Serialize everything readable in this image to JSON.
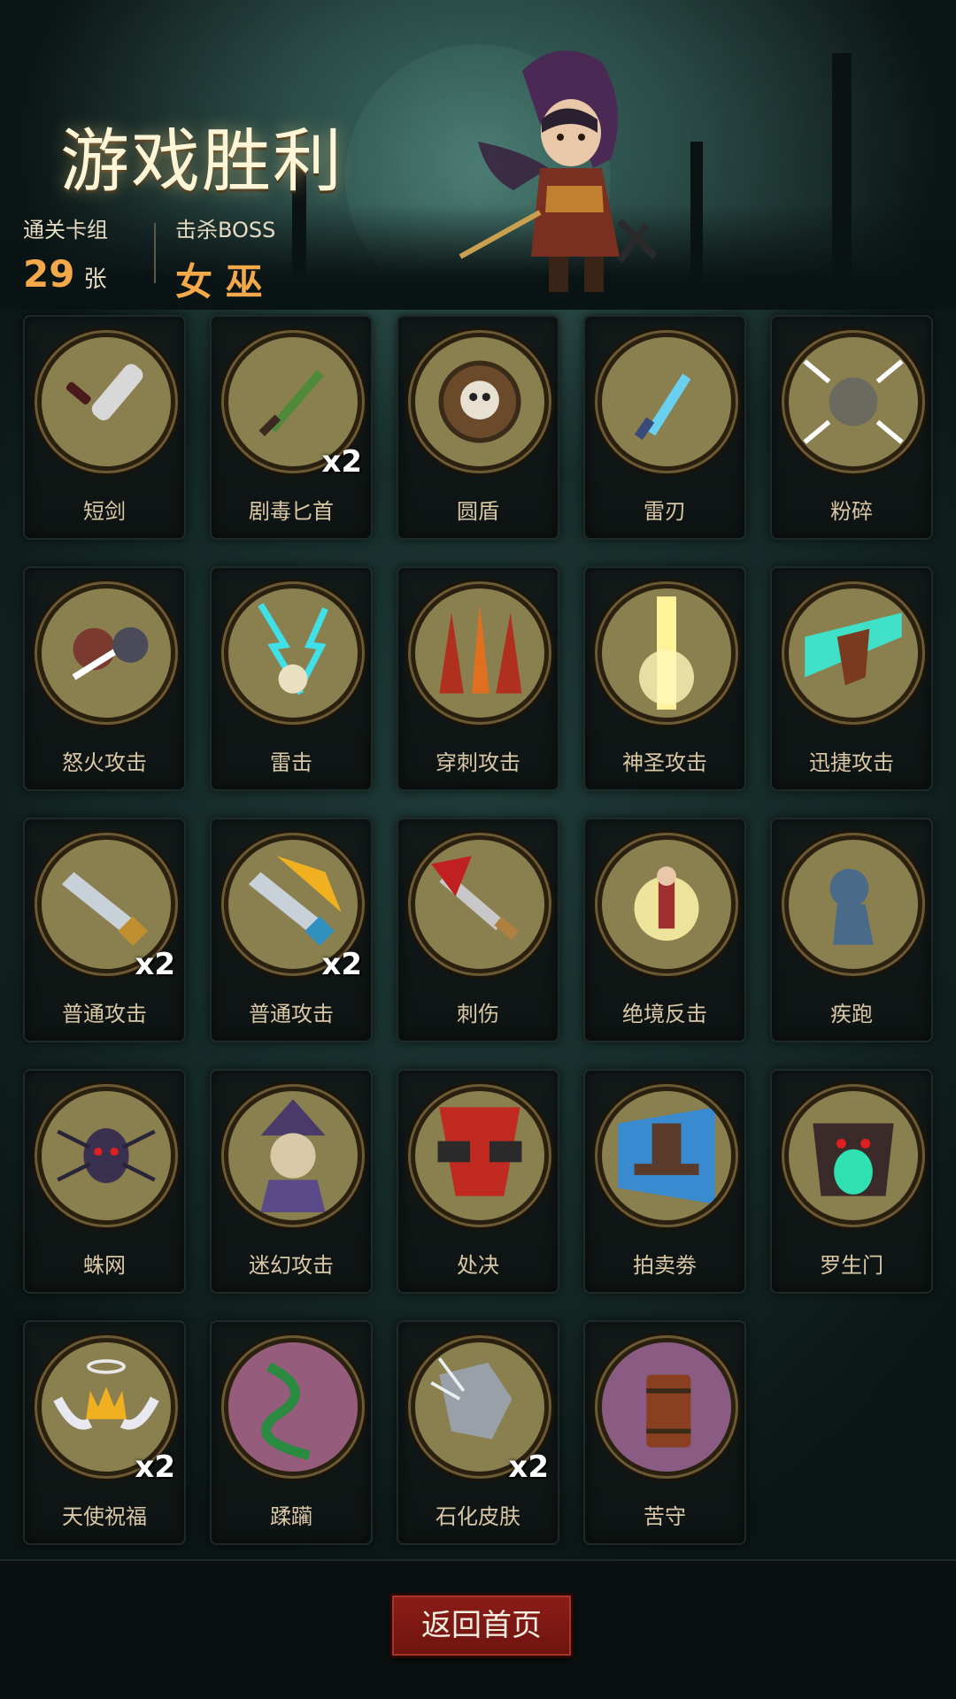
{
  "header": {
    "title": "游戏胜利",
    "cleared_deck_label": "通关卡组",
    "cleared_deck_count": "29",
    "cleared_deck_unit": "张",
    "boss_label": "击杀BOSS",
    "boss_name": "女 巫"
  },
  "cards": [
    {
      "name": "短剑",
      "icon": "short-sword-icon",
      "count": ""
    },
    {
      "name": "剧毒匕首",
      "icon": "poison-dagger-icon",
      "count": "x2"
    },
    {
      "name": "圆盾",
      "icon": "round-shield-icon",
      "count": ""
    },
    {
      "name": "雷刃",
      "icon": "thunder-blade-icon",
      "count": ""
    },
    {
      "name": "粉碎",
      "icon": "shatter-icon",
      "count": ""
    },
    {
      "name": "怒火攻击",
      "icon": "rage-attack-icon",
      "count": ""
    },
    {
      "name": "雷击",
      "icon": "lightning-strike-icon",
      "count": ""
    },
    {
      "name": "穿刺攻击",
      "icon": "pierce-attack-icon",
      "count": ""
    },
    {
      "name": "神圣攻击",
      "icon": "holy-attack-icon",
      "count": ""
    },
    {
      "name": "迅捷攻击",
      "icon": "swift-attack-icon",
      "count": ""
    },
    {
      "name": "普通攻击",
      "icon": "basic-attack-icon",
      "count": "x2"
    },
    {
      "name": "普通攻击",
      "icon": "basic-attack-fire-icon",
      "count": "x2"
    },
    {
      "name": "刺伤",
      "icon": "stab-icon",
      "count": ""
    },
    {
      "name": "绝境反击",
      "icon": "desperate-counter-icon",
      "count": ""
    },
    {
      "name": "疾跑",
      "icon": "sprint-icon",
      "count": ""
    },
    {
      "name": "蛛网",
      "icon": "spider-web-icon",
      "count": ""
    },
    {
      "name": "迷幻攻击",
      "icon": "illusion-attack-icon",
      "count": ""
    },
    {
      "name": "处决",
      "icon": "execution-icon",
      "count": ""
    },
    {
      "name": "拍卖劵",
      "icon": "auction-ticket-icon",
      "count": ""
    },
    {
      "name": "罗生门",
      "icon": "rashomon-icon",
      "count": ""
    },
    {
      "name": "天使祝福",
      "icon": "angel-blessing-icon",
      "count": "x2"
    },
    {
      "name": "蹂躏",
      "icon": "ravage-icon",
      "count": ""
    },
    {
      "name": "石化皮肤",
      "icon": "stone-skin-icon",
      "count": "x2"
    },
    {
      "name": "苦守",
      "icon": "stubborn-defense-icon",
      "count": ""
    }
  ],
  "footer": {
    "home_button_label": "返回首页"
  },
  "colors": {
    "accent_orange": "#f3a94a",
    "button_red": "#8c1c17",
    "medal_olive": "#8a7f4f",
    "background": "#0f1c1c"
  }
}
